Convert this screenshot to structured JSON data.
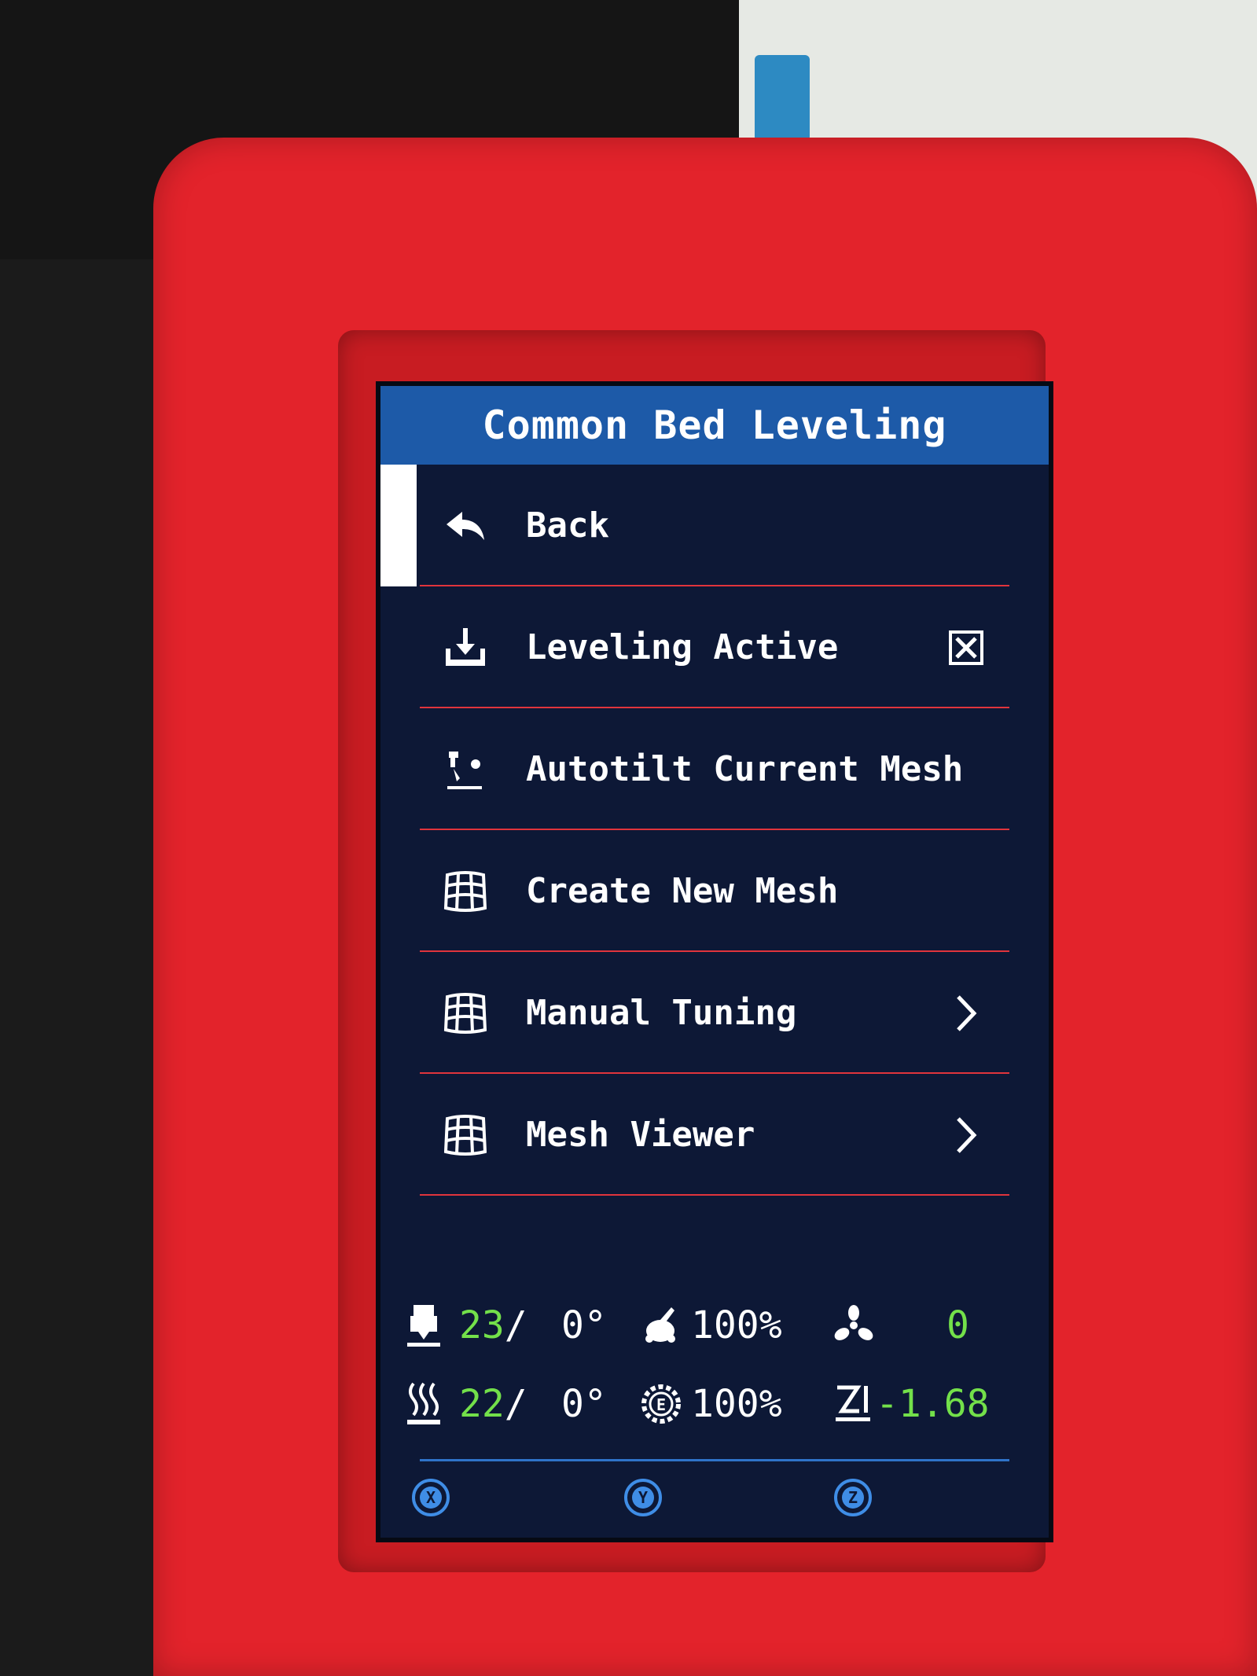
{
  "screen": {
    "title": "Common Bed Leveling",
    "menu": [
      {
        "label": "Back",
        "icon": "back-arrow-icon"
      },
      {
        "label": "Leveling Active",
        "icon": "leveling-icon",
        "right": "checkbox-checked-icon"
      },
      {
        "label": "Autotilt Current Mesh",
        "icon": "probe-icon"
      },
      {
        "label": "Create New Mesh",
        "icon": "mesh-grid-icon"
      },
      {
        "label": "Manual Tuning",
        "icon": "mesh-grid-icon",
        "right": "chevron-right-icon"
      },
      {
        "label": "Mesh Viewer",
        "icon": "mesh-grid-icon",
        "right": "chevron-right-icon"
      }
    ],
    "status": {
      "hotend_temp": "23",
      "hotend_sep": "/",
      "hotend_target": "0°",
      "speed": "100%",
      "fan": "0",
      "bed_temp": "22",
      "bed_sep": "/",
      "bed_target": "0°",
      "flow": "100%",
      "z_offset": "-1.68"
    },
    "axes": [
      "X",
      "Y",
      "Z"
    ]
  },
  "colors": {
    "title_bar": "#1d5aa8",
    "screen_bg": "#0d1836",
    "separator": "#e0343c",
    "status_value": "#73e04a",
    "enclosure": "#e3232b"
  }
}
